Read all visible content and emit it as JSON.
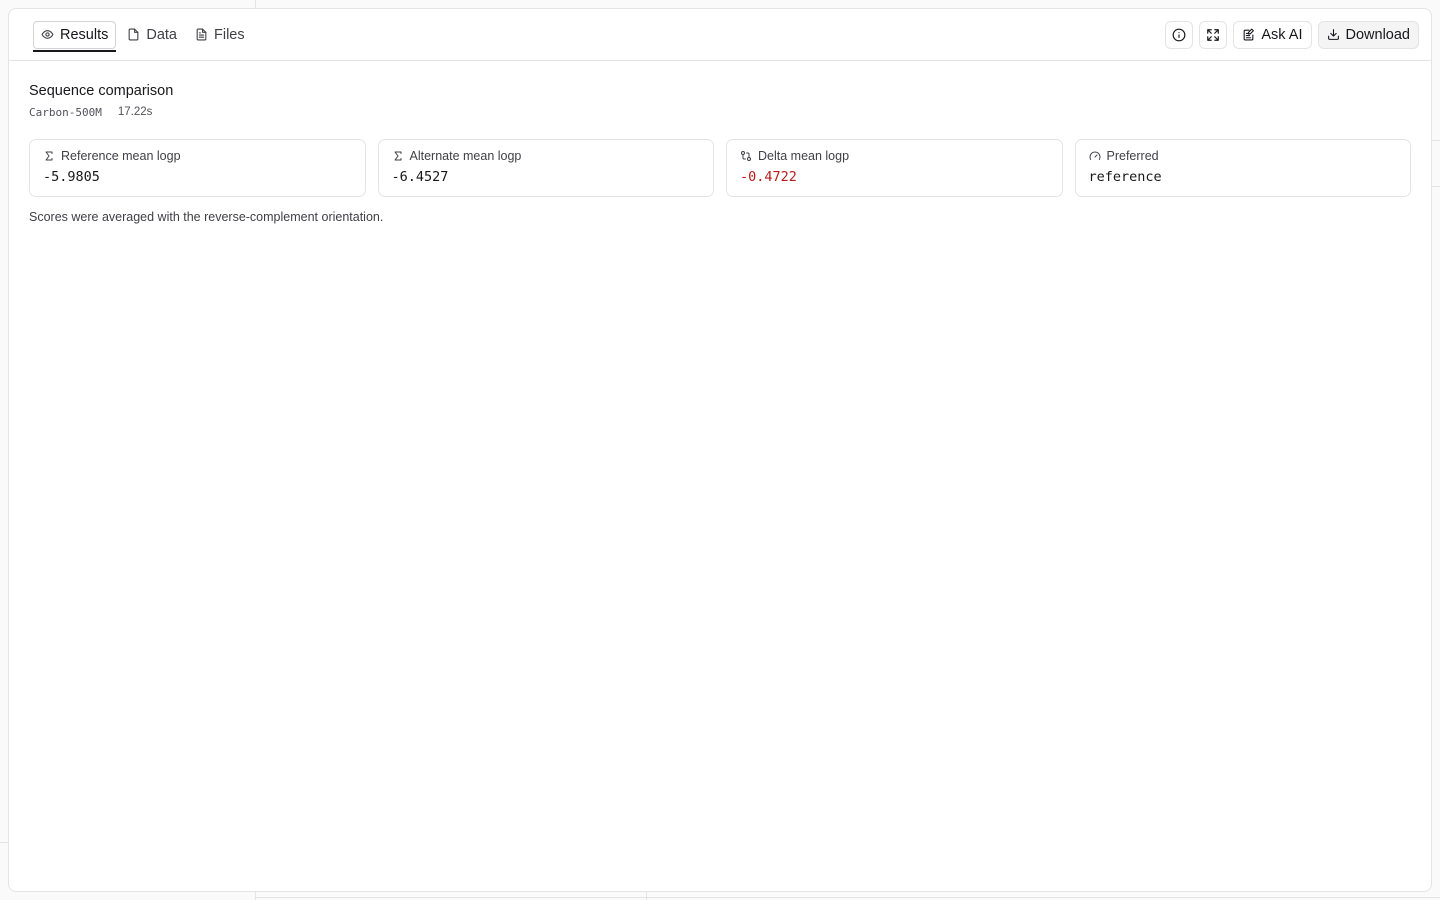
{
  "tabs": [
    {
      "label": "Results",
      "icon": "eye-icon",
      "active": true
    },
    {
      "label": "Data",
      "icon": "file-icon",
      "active": false
    },
    {
      "label": "Files",
      "icon": "file-text-icon",
      "active": false
    }
  ],
  "actions": {
    "info_icon": "info-icon",
    "expand_icon": "expand-icon",
    "ask_ai_label": "Ask AI",
    "download_label": "Download"
  },
  "result": {
    "title": "Sequence comparison",
    "model": "Carbon-500M",
    "duration": "17.22s",
    "note": "Scores were averaged with the reverse-complement orientation."
  },
  "metrics": [
    {
      "label": "Reference mean logp",
      "value": "-5.9805",
      "icon": "sigma-icon"
    },
    {
      "label": "Alternate mean logp",
      "value": "-6.4527",
      "icon": "sigma-icon"
    },
    {
      "label": "Delta mean logp",
      "value": "-0.4722",
      "icon": "git-compare-icon",
      "color": "#b91c1c"
    },
    {
      "label": "Preferred",
      "value": "reference",
      "icon": "gauge-icon"
    }
  ]
}
